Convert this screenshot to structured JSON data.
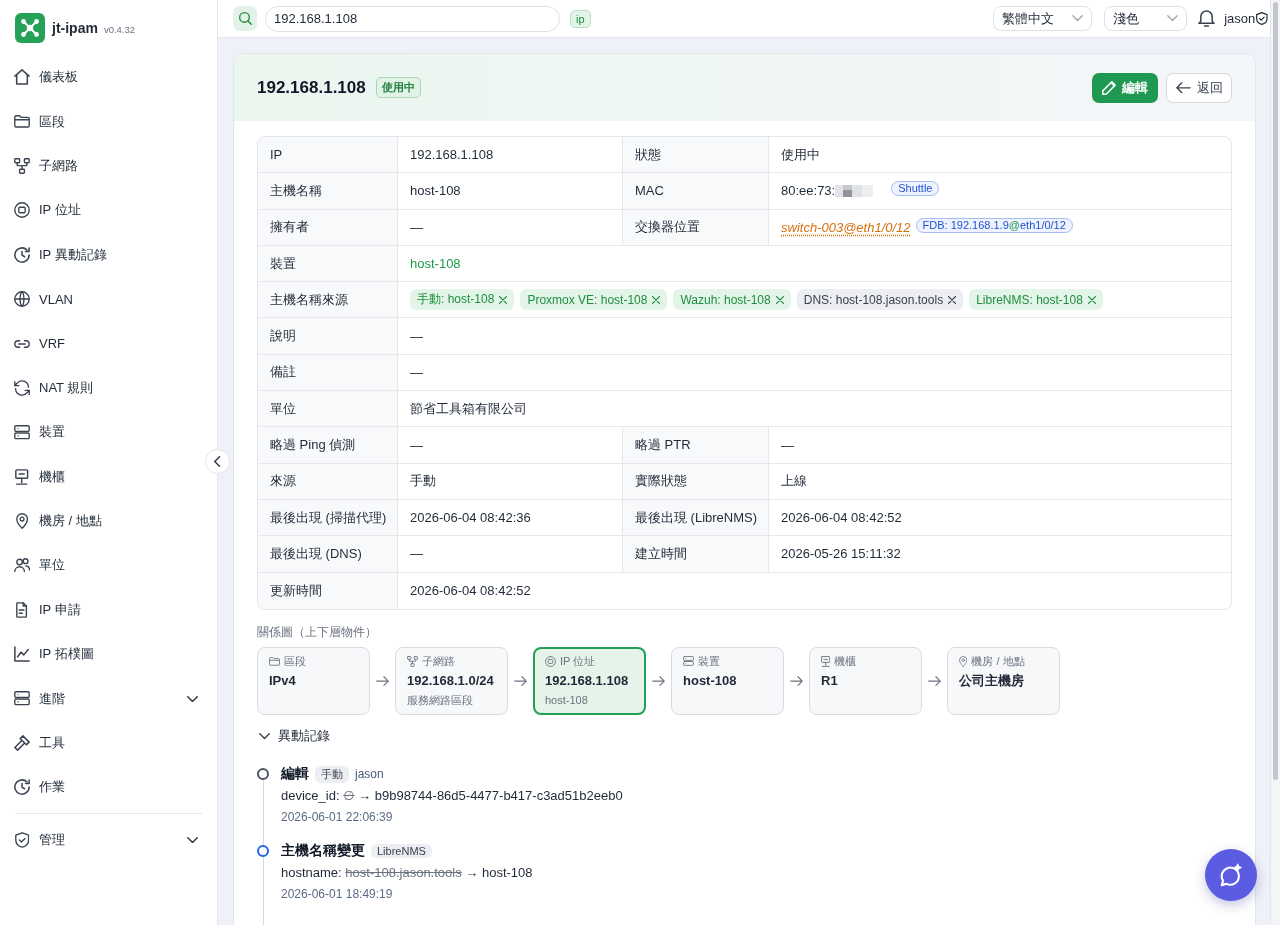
{
  "sidebar": {
    "app_name": "jt-ipam",
    "version": "v0.4.32",
    "sections": [
      {
        "items": [
          {
            "label": "儀表板",
            "kind": "link",
            "selected": false
          },
          {
            "label": "區段",
            "kind": "link",
            "selected": false
          },
          {
            "label": "子網路",
            "kind": "link",
            "selected": false
          },
          {
            "label": "IP 位址",
            "kind": "link",
            "selected": false
          },
          {
            "label": "IP 異動記錄",
            "kind": "link",
            "selected": false
          },
          {
            "label": "VLAN",
            "kind": "link",
            "selected": false
          },
          {
            "label": "VRF",
            "kind": "link",
            "selected": false
          },
          {
            "label": "NAT 規則",
            "kind": "link",
            "selected": false
          },
          {
            "label": "裝置",
            "kind": "link",
            "selected": false
          },
          {
            "label": "機櫃",
            "kind": "link",
            "selected": false
          },
          {
            "label": "機房 / 地點",
            "kind": "link",
            "selected": false
          },
          {
            "label": "單位",
            "kind": "link",
            "selected": false
          },
          {
            "label": "IP 申請",
            "kind": "link",
            "selected": false
          },
          {
            "label": "IP 拓樸圖",
            "kind": "link",
            "selected": false
          },
          {
            "label": "進階",
            "kind": "group",
            "selected": false,
            "expanded": false
          },
          {
            "label": "工具",
            "kind": "link",
            "selected": false
          },
          {
            "label": "作業",
            "kind": "link",
            "selected": false
          }
        ]
      },
      {
        "items": [
          {
            "label": "管理",
            "kind": "group",
            "selected": false,
            "expanded": false
          }
        ]
      }
    ]
  },
  "header": {
    "search": {
      "value": "192.168.1.108"
    },
    "search_type": "ip",
    "language": "繁體中文",
    "theme": "淺色",
    "user": "jason"
  },
  "record": {
    "title": "192.168.1.108",
    "status": "使用中",
    "buttons": [
      {
        "label": "編輯",
        "kind": "primary"
      },
      {
        "label": "返回",
        "kind": "back"
      }
    ],
    "details": [
      {
        "fields": [
          {
            "label": "IP",
            "kind": "text",
            "value": "192.168.1.108"
          },
          {
            "label": "狀態",
            "kind": "text",
            "value": "使用中"
          }
        ]
      },
      {
        "fields": [
          {
            "label": "主機名稱",
            "kind": "text",
            "value": "host-108"
          },
          {
            "label": "MAC",
            "kind": "mac",
            "value": "80:ee:73:",
            "vendor": "Shuttle"
          }
        ]
      },
      {
        "fields": [
          {
            "label": "擁有者",
            "kind": "text",
            "value": "—"
          },
          {
            "label": "交換器位置",
            "kind": "switch_port",
            "link": "switch-003@eth1/0/12",
            "fdb": {
              "prefix": "FDB: 192.168.1.9",
              "at": "@",
              "port": "eth1/0/12"
            }
          }
        ]
      },
      {
        "fields": [
          {
            "label": "裝置",
            "kind": "link",
            "value": "host-108"
          }
        ]
      },
      {
        "fields": [
          {
            "label": "主機名稱來源",
            "kind": "chips",
            "chips": [
              {
                "text": "手動: host-108",
                "active": true
              },
              {
                "text": "Proxmox VE: host-108",
                "active": true
              },
              {
                "text": "Wazuh: host-108",
                "active": true
              },
              {
                "text": "DNS: host-108.jason.tools",
                "active": false
              },
              {
                "text": "LibreNMS: host-108",
                "active": true
              }
            ]
          }
        ]
      },
      {
        "fields": [
          {
            "label": "說明",
            "kind": "text",
            "value": "—"
          }
        ]
      },
      {
        "fields": [
          {
            "label": "備註",
            "kind": "text",
            "value": "—"
          }
        ]
      },
      {
        "fields": [
          {
            "label": "單位",
            "kind": "text",
            "value": "節省工具箱有限公司"
          }
        ]
      },
      {
        "fields": [
          {
            "label": "略過 Ping 偵測",
            "kind": "text",
            "value": "—"
          },
          {
            "label": "略過 PTR",
            "kind": "text",
            "value": "—"
          }
        ]
      },
      {
        "fields": [
          {
            "label": "來源",
            "kind": "text",
            "value": "手動"
          },
          {
            "label": "實際狀態",
            "kind": "text",
            "value": "上線"
          }
        ]
      },
      {
        "fields": [
          {
            "label": "最後出現 (掃描代理)",
            "kind": "text",
            "value": "2026-06-04 08:42:36"
          },
          {
            "label": "最後出現 (LibreNMS)",
            "kind": "text",
            "value": "2026-06-04 08:42:52"
          }
        ]
      },
      {
        "fields": [
          {
            "label": "最後出現 (DNS)",
            "kind": "text",
            "value": "—"
          },
          {
            "label": "建立時間",
            "kind": "text",
            "value": "2026-05-26 15:11:32"
          }
        ]
      },
      {
        "fields": [
          {
            "label": "更新時間",
            "kind": "text",
            "value": "2026-06-04 08:42:52"
          }
        ]
      }
    ],
    "relations": {
      "title": "關係圖（上下層物件）",
      "nodes": [
        {
          "type": "區段",
          "title": "IPv4",
          "selected": false
        },
        {
          "type": "子網路",
          "title": "192.168.1.0/24",
          "subtitle": "服務網路區段",
          "selected": false
        },
        {
          "type": "IP 位址",
          "title": "192.168.1.108",
          "subtitle": "host-108",
          "selected": true
        },
        {
          "type": "裝置",
          "title": "host-108",
          "selected": false
        },
        {
          "type": "機櫃",
          "title": "R1",
          "selected": false
        },
        {
          "type": "機房 / 地點",
          "title": "公司主機房",
          "selected": false
        }
      ]
    },
    "history": {
      "title": "異動記錄",
      "expanded": true,
      "entries": [
        {
          "action": "編輯",
          "source": "手動",
          "user": "jason",
          "field": "device_id:",
          "old": "∅",
          "arrow": "→",
          "new": "b9b98744-86d5-4477-b417-c3ad51b2eeb0",
          "time": "2026-06-01 22:06:39",
          "color": "#4b5563"
        },
        {
          "action": "主機名稱變更",
          "source": "LibreNMS",
          "field": "hostname:",
          "old": "host-108.jason.tools",
          "arrow": "→",
          "new": "host-108",
          "time": "2026-06-01 18:49:19",
          "color": "#2563eb"
        }
      ]
    }
  }
}
